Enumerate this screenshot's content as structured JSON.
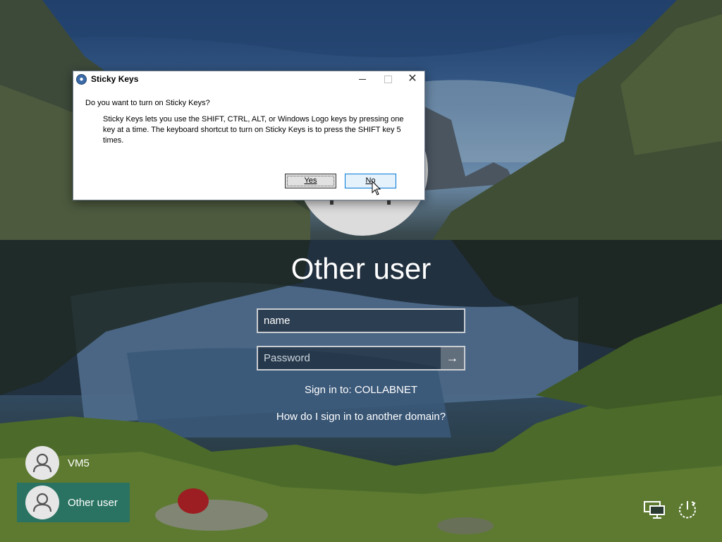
{
  "dialog": {
    "title": "Sticky Keys",
    "question": "Do you want to turn on Sticky Keys?",
    "description": "Sticky Keys lets you use the SHIFT, CTRL, ALT, or Windows Logo keys by pressing one key at a time. The keyboard shortcut to turn on Sticky Keys is to press the SHIFT key 5 times.",
    "yes_label": "Yes",
    "no_label": "No"
  },
  "signin": {
    "title": "Other user",
    "name_value": "name",
    "password_placeholder": "Password",
    "signin_to": "Sign in to: COLLABNET",
    "domain_help": "How do I sign in to another domain?"
  },
  "users": [
    {
      "name": "VM5",
      "selected": false
    },
    {
      "name": "Other user",
      "selected": true
    }
  ],
  "icons": {
    "network": "network-icon",
    "power": "power-icon",
    "ease_of_access": "ease-of-access-icon"
  }
}
